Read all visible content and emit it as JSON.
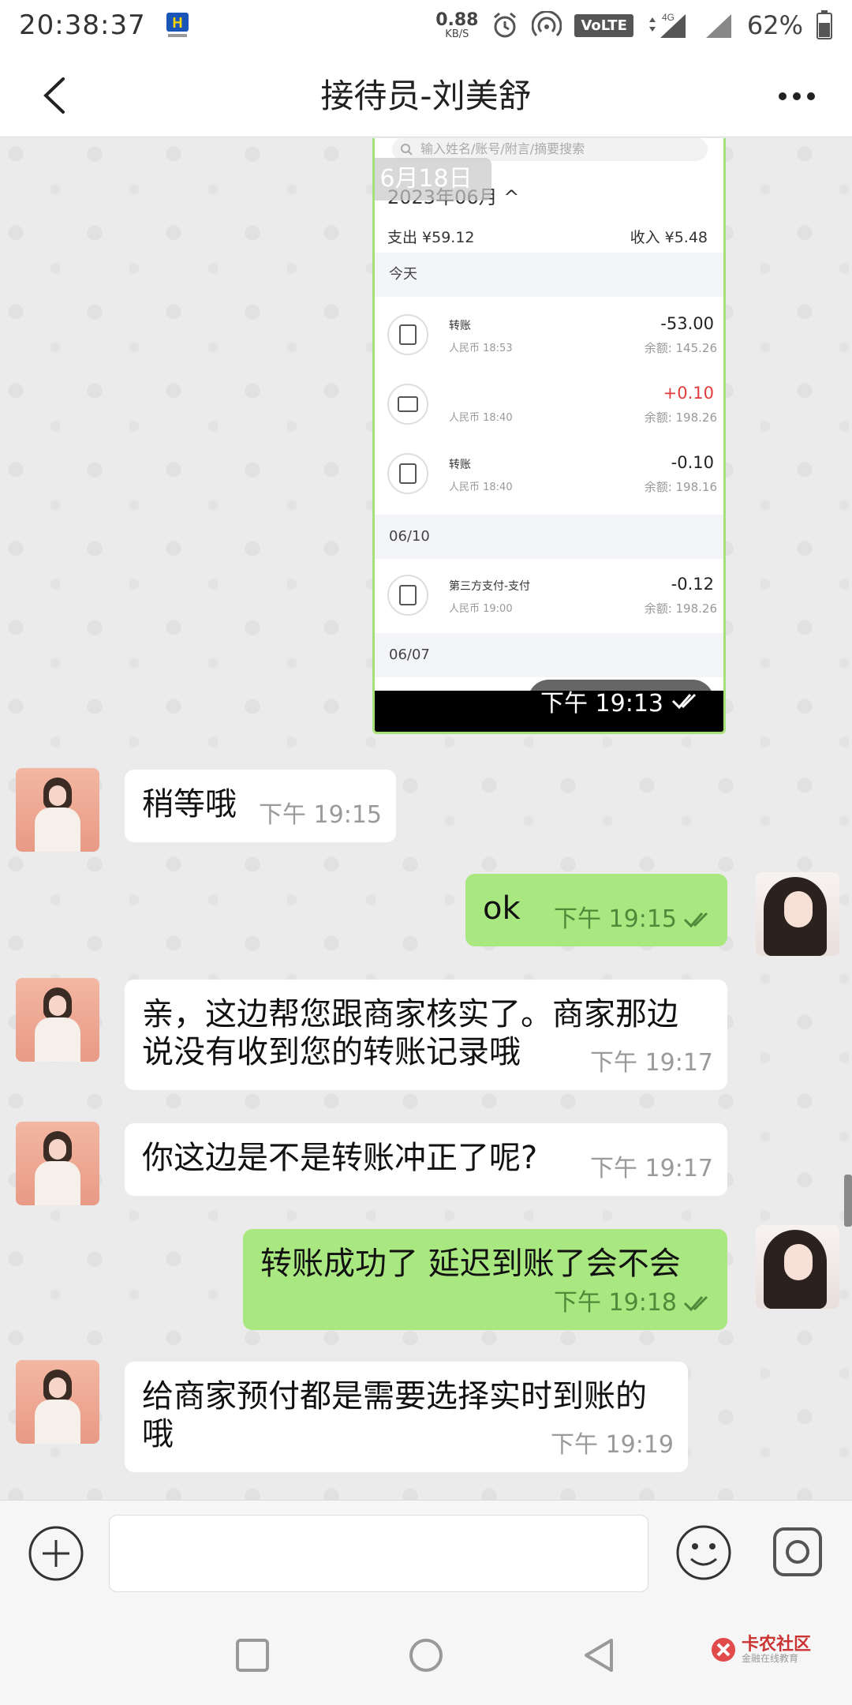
{
  "status_bar": {
    "time": "20:38:37",
    "net_speed_value": "0.88",
    "net_speed_unit": "KB/S",
    "volte": "VoLTE",
    "network": "4G",
    "battery": "62%"
  },
  "header": {
    "title": "接待员-刘美舒"
  },
  "screenshot_msg": {
    "search_placeholder": "输入姓名/账号/附言/摘要搜索",
    "date_pill": "6月18日",
    "month": "2023年06月 ^",
    "expense": "支出 ¥59.12",
    "income": "收入 ¥5.48",
    "sections": [
      "今天",
      "06/10",
      "06/07"
    ],
    "transactions": [
      {
        "name": "转账",
        "sub": "人民币 18:53",
        "amount": "-53.00",
        "balance": "余额: 145.26",
        "color": "#222222"
      },
      {
        "name": "",
        "sub": "人民币 18:40",
        "amount": "+0.10",
        "balance": "余额: 198.26",
        "color": "#e23b3b"
      },
      {
        "name": "转账",
        "sub": "人民币 18:40",
        "amount": "-0.10",
        "balance": "余额: 198.16",
        "color": "#222222"
      },
      {
        "name": "第三方支付-支付",
        "sub": "人民币 19:00",
        "amount": "-0.12",
        "balance": "余额: 198.26",
        "color": "#222222"
      }
    ],
    "time": "下午 19:13"
  },
  "messages": [
    {
      "dir": "in",
      "text": "稍等哦",
      "time": "下午 19:15"
    },
    {
      "dir": "out",
      "text": "ok",
      "time": "下午 19:15"
    },
    {
      "dir": "in",
      "text": "亲，这边帮您跟商家核实了。商家那边说没有收到您的转账记录哦",
      "time": "下午 19:17"
    },
    {
      "dir": "in",
      "text": "你这边是不是转账冲正了呢?",
      "time": "下午 19:17"
    },
    {
      "dir": "out",
      "text": "转账成功了 延迟到账了会不会",
      "time": "下午 19:18"
    },
    {
      "dir": "in",
      "text": "给商家预付都是需要选择实时到账的哦",
      "time": "下午 19:19"
    }
  ],
  "input": {
    "value": "",
    "placeholder": ""
  },
  "watermark": {
    "title": "卡农社区",
    "sub": "金融在线教育"
  },
  "colors": {
    "out_bubble": "#a9e880",
    "in_bubble": "#ffffff",
    "chat_bg": "#ebebeb"
  }
}
